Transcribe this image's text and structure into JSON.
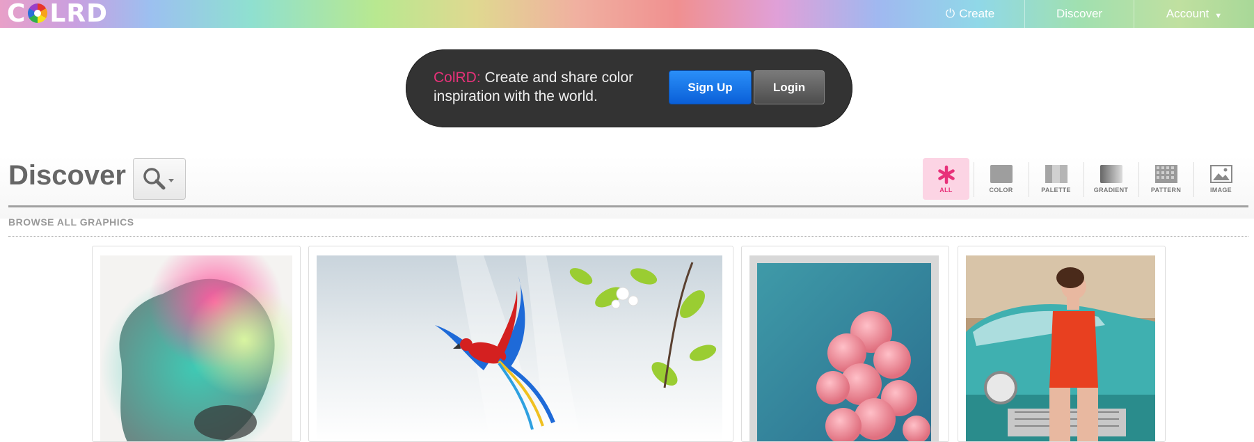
{
  "header": {
    "logo_text_left": "C",
    "logo_text_right": "LRD",
    "nav": {
      "create": "Create",
      "discover": "Discover",
      "account": "Account"
    }
  },
  "banner": {
    "brand": "ColRD:",
    "tagline": " Create and share color inspiration with the world.",
    "signup": "Sign Up",
    "login": "Login"
  },
  "discover": {
    "title": "Discover",
    "filters": [
      "ALL",
      "COLOR",
      "PALETTE",
      "GRADIENT",
      "PATTERN",
      "IMAGE"
    ],
    "active_filter": "ALL",
    "subheading": "BROWSE ALL GRAPHICS"
  },
  "colors": {
    "brand_pink": "#e8317a",
    "signup_blue": "#1a7af0",
    "banner_bg": "#333333"
  }
}
